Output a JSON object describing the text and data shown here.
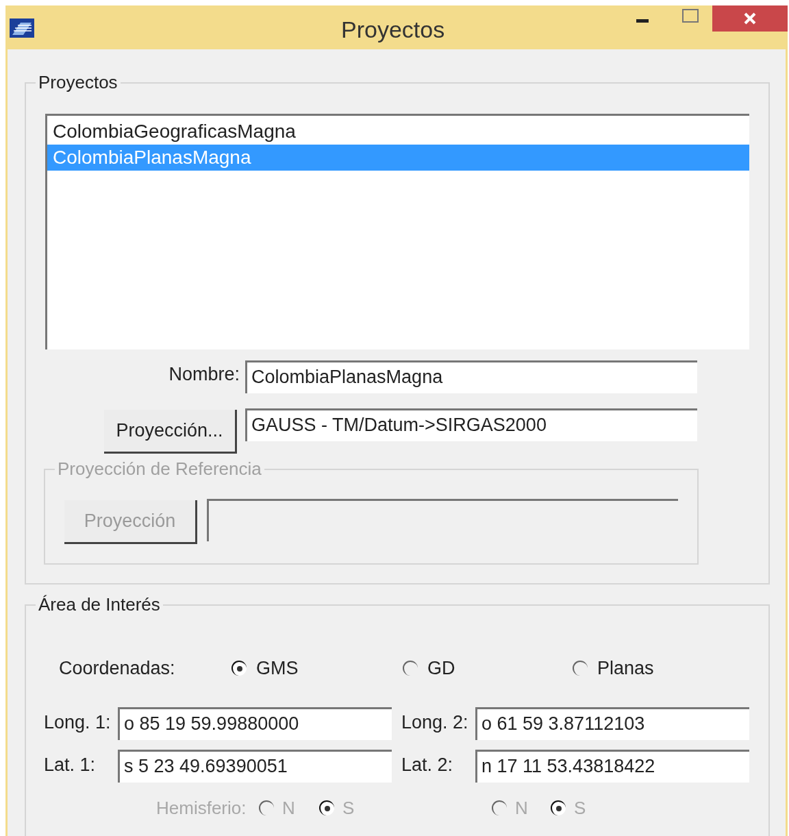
{
  "window": {
    "title": "Proyectos"
  },
  "projects": {
    "title": "Proyectos",
    "items": [
      {
        "label": "ColombiaGeograficasMagna",
        "selected": false
      },
      {
        "label": "ColombiaPlanasMagna",
        "selected": true
      }
    ],
    "name": {
      "label": "Nombre:",
      "value": "ColombiaPlanasMagna"
    },
    "projection": {
      "button": "Proyección...",
      "value": "GAUSS - TM/Datum->SIRGAS2000"
    },
    "reference": {
      "title": "Proyección de Referencia",
      "disabled": true,
      "button": "Proyección"
    }
  },
  "area": {
    "title": "Área de Interés",
    "coordinates_label": "Coordenadas:",
    "coordinate_options": [
      {
        "label": "GMS",
        "selected": true
      },
      {
        "label": "GD",
        "selected": false
      },
      {
        "label": "Planas",
        "selected": false
      }
    ],
    "fields": [
      {
        "label": "Long. 1:",
        "value": "o 85 19 59.99880000"
      },
      {
        "label": "Long. 2:",
        "value": "o 61 59 3.87112103"
      },
      {
        "label": "Lat. 1:",
        "value": "s 5 23 49.69390051"
      },
      {
        "label": "Lat. 2:",
        "value": "n 17 11 53.43818422"
      }
    ],
    "hemisphere": {
      "label": "Hemisferio:",
      "disabled": true,
      "groups": [
        [
          {
            "label": "N",
            "selected": false
          },
          {
            "label": "S",
            "selected": true
          }
        ],
        [
          {
            "label": "N",
            "selected": false
          },
          {
            "label": "S",
            "selected": true
          }
        ]
      ]
    }
  }
}
